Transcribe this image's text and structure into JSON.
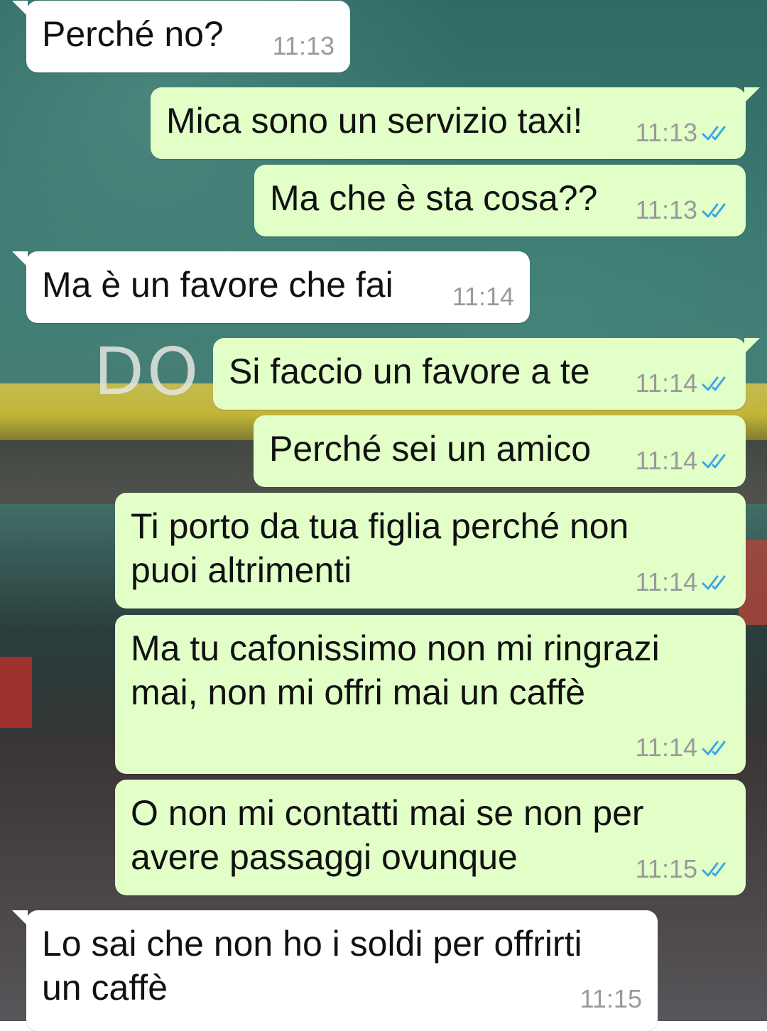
{
  "colors": {
    "incoming_bubble": "#ffffff",
    "outgoing_bubble": "#e2ffc8",
    "read_ticks": "#3aa6e8",
    "timestamp": "#9a9a9a",
    "message_text": "#111111"
  },
  "messages": [
    {
      "direction": "incoming",
      "text": "Perché no?",
      "time": "11:13"
    },
    {
      "direction": "outgoing",
      "text": "Mica sono un servizio taxi!",
      "time": "11:13",
      "status": "read"
    },
    {
      "direction": "outgoing",
      "text": "Ma che è sta cosa??",
      "time": "11:13",
      "status": "read"
    },
    {
      "direction": "incoming",
      "text": "Ma è un favore che fai",
      "time": "11:14"
    },
    {
      "direction": "outgoing",
      "text": "Si faccio un favore a te",
      "time": "11:14",
      "status": "read"
    },
    {
      "direction": "outgoing",
      "text": "Perché sei un amico",
      "time": "11:14",
      "status": "read"
    },
    {
      "direction": "outgoing",
      "text": "Ti porto da tua figlia perché non puoi altrimenti",
      "time": "11:14",
      "status": "read"
    },
    {
      "direction": "outgoing",
      "text": "Ma tu cafonissimo non mi ringrazi mai, non mi offri mai un caffè",
      "time": "11:14",
      "status": "read"
    },
    {
      "direction": "outgoing",
      "text": "O non mi contatti mai se non per avere passaggi ovunque",
      "time": "11:15",
      "status": "read"
    },
    {
      "direction": "incoming",
      "text": "Lo sai che non ho i soldi per offrirti un caffè",
      "time": "11:15"
    }
  ],
  "icons": {
    "read_status": "double-check-icon"
  }
}
